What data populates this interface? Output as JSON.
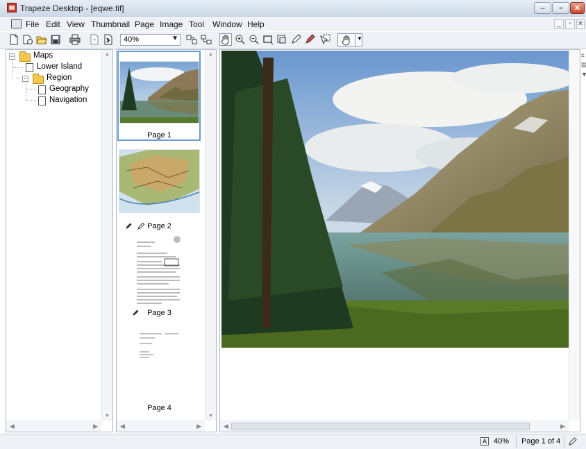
{
  "window": {
    "title": "Trapeze Desktop - [eqwe.tif]",
    "minimize_glyph": "–",
    "maximize_glyph": "▫",
    "close_glyph": "✕"
  },
  "menu": {
    "items": [
      "File",
      "Edit",
      "View",
      "Thumbnail",
      "Page",
      "Image",
      "Tool",
      "Window",
      "Help"
    ],
    "mdi_minimize": "_",
    "mdi_restore": "▫",
    "mdi_close": "✕"
  },
  "toolbar": {
    "zoom_value": "40%",
    "tools": [
      "new-document-icon",
      "new-from-template-icon",
      "open-folder-icon",
      "save-icon",
      "print-icon",
      "import-icon",
      "export-icon",
      "split-view-icon",
      "merge-view-icon",
      "pan-hand-icon",
      "zoom-in-icon",
      "zoom-out-icon",
      "select-rectangle-icon",
      "crop-icon",
      "annotate-pen-icon",
      "highlight-marker-icon",
      "select-tool-icon",
      "hand-dropdown-icon"
    ]
  },
  "tree": {
    "root": "Maps",
    "items": [
      {
        "label": "Lower Island"
      },
      {
        "label": "Region",
        "children": [
          {
            "label": "Geography"
          },
          {
            "label": "Navigation"
          }
        ]
      }
    ]
  },
  "thumbnails": [
    {
      "label": "Page 1",
      "selected": true
    },
    {
      "label": "Page 2",
      "annotated": true
    },
    {
      "label": "Page 3",
      "annotated": true
    },
    {
      "label": "Page 4"
    }
  ],
  "statusbar": {
    "zoom": "40%",
    "page_indicator": "Page 1 of 4",
    "zoom_icon_glyph": "A"
  },
  "colors": {
    "accent": "#6a9bd1",
    "titlebar": "#cdd9e8",
    "close_button": "#c9472c"
  }
}
